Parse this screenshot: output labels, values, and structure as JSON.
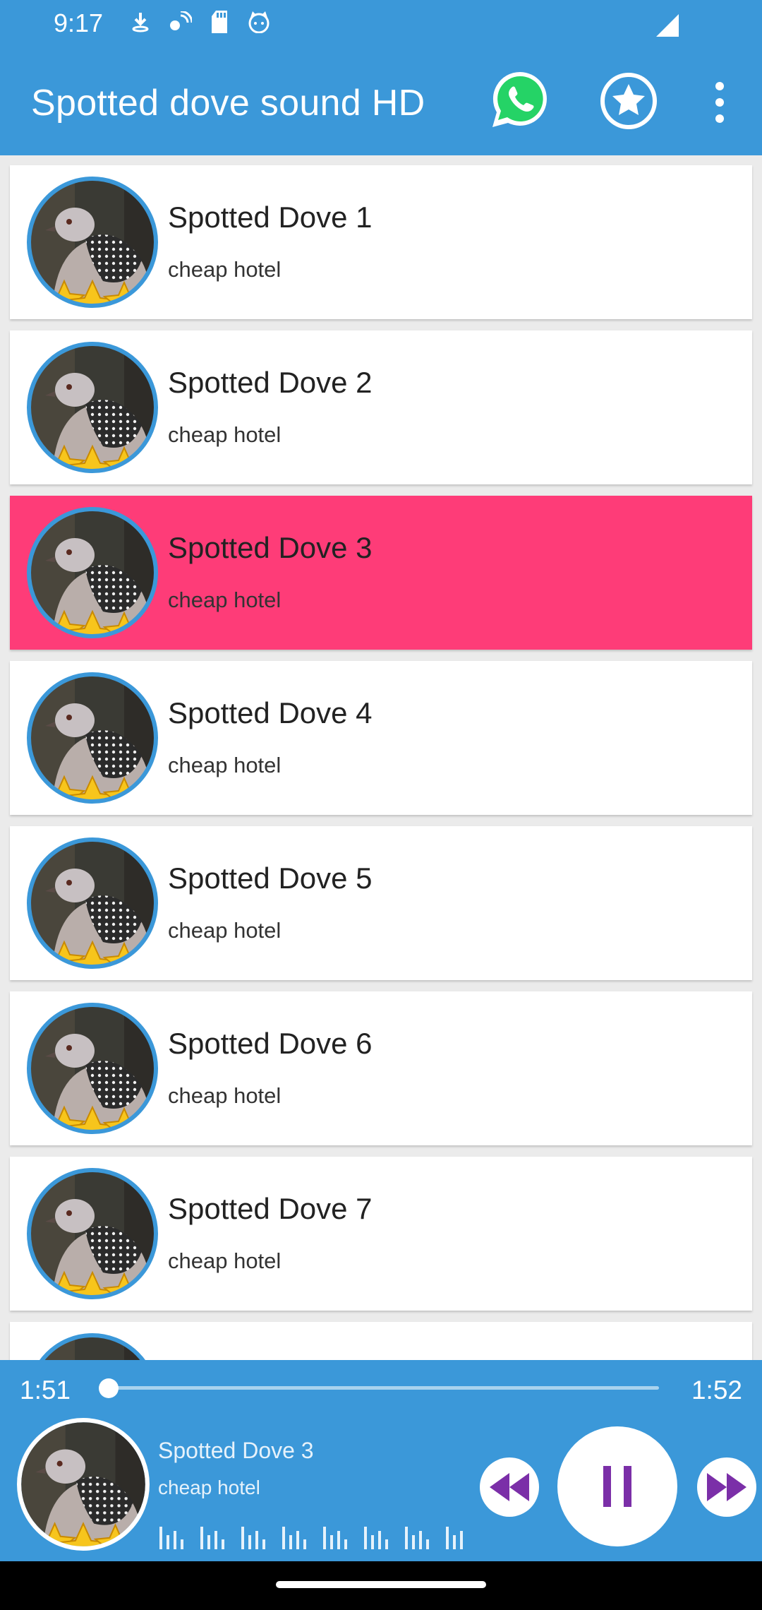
{
  "status_bar": {
    "time": "9:17",
    "icons": [
      "download-icon",
      "wifi-calling-icon",
      "sd-card-icon",
      "cat-face-icon",
      "cellular-signal-icon"
    ]
  },
  "app_bar": {
    "title": "Spotted dove sound HD",
    "actions": [
      "whatsapp-icon",
      "star-circle-icon",
      "more-vert-icon"
    ]
  },
  "list": {
    "items": [
      {
        "title": "Spotted Dove 1",
        "subtitle": "cheap hotel",
        "active": false
      },
      {
        "title": "Spotted Dove 2",
        "subtitle": "cheap hotel",
        "active": false
      },
      {
        "title": "Spotted Dove 3",
        "subtitle": "cheap hotel",
        "active": true
      },
      {
        "title": "Spotted Dove 4",
        "subtitle": "cheap hotel",
        "active": false
      },
      {
        "title": "Spotted Dove 5",
        "subtitle": "cheap hotel",
        "active": false
      },
      {
        "title": "Spotted Dove 6",
        "subtitle": "cheap hotel",
        "active": false
      },
      {
        "title": "Spotted Dove 7",
        "subtitle": "cheap hotel",
        "active": false
      }
    ]
  },
  "player": {
    "current_time": "1:51",
    "total_time": "1:52",
    "progress_fraction": 0.01,
    "title": "Spotted Dove 3",
    "subtitle": "cheap hotel"
  },
  "colors": {
    "primary": "#3b98d9",
    "active_row": "#fe3c78",
    "control_purple": "#7b2fa8",
    "whatsapp_green": "#25d366"
  }
}
